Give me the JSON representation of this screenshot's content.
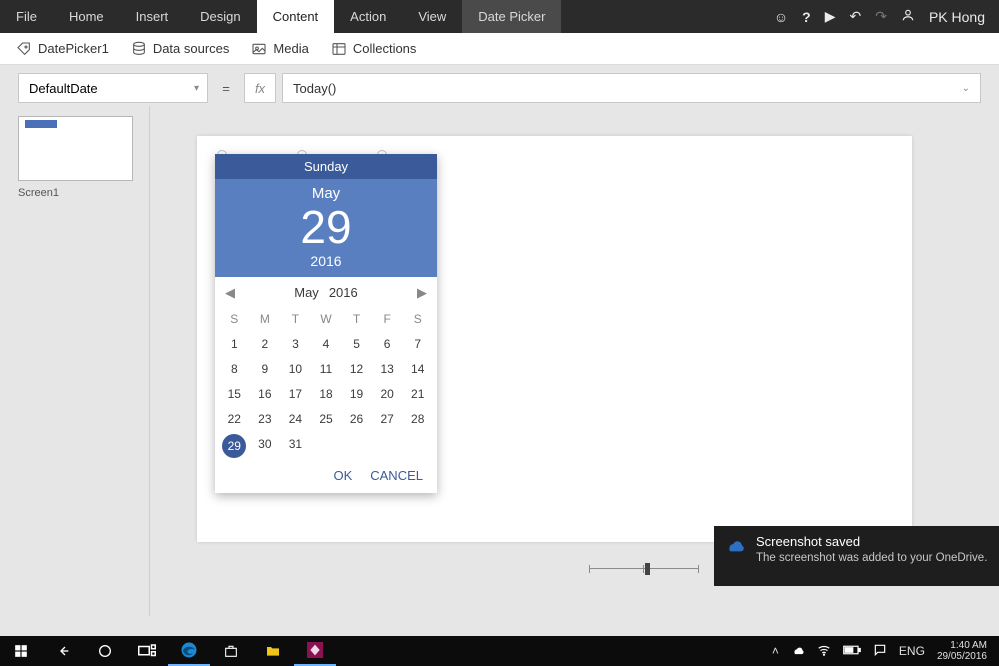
{
  "tabs": {
    "file": "File",
    "home": "Home",
    "insert": "Insert",
    "design": "Design",
    "content": "Content",
    "action": "Action",
    "view": "View",
    "datepicker": "Date Picker"
  },
  "user": {
    "name": "PK Hong"
  },
  "ribbon": {
    "control_name": "DatePicker1",
    "data_sources": "Data sources",
    "media": "Media",
    "collections": "Collections"
  },
  "formula": {
    "property": "DefaultDate",
    "fx_label": "fx",
    "expression": "Today()"
  },
  "thumbs": {
    "screen1": "Screen1"
  },
  "datepicker": {
    "dow_long": "Sunday",
    "month_long": "May",
    "day_num": "29",
    "year": "2016",
    "nav_month": "May",
    "nav_year": "2016",
    "dows": [
      "S",
      "M",
      "T",
      "W",
      "T",
      "F",
      "S"
    ],
    "weeks": [
      [
        "1",
        "2",
        "3",
        "4",
        "5",
        "6",
        "7"
      ],
      [
        "8",
        "9",
        "10",
        "11",
        "12",
        "13",
        "14"
      ],
      [
        "15",
        "16",
        "17",
        "18",
        "19",
        "20",
        "21"
      ],
      [
        "22",
        "23",
        "24",
        "25",
        "26",
        "27",
        "28"
      ],
      [
        "29",
        "30",
        "31",
        "",
        "",
        "",
        ""
      ]
    ],
    "selected_day": "29",
    "ok": "OK",
    "cancel": "CANCEL"
  },
  "toast": {
    "title": "Screenshot saved",
    "body": "The screenshot was added to your OneDrive."
  },
  "taskbar": {
    "lang": "ENG",
    "time": "1:40 AM",
    "date": "29/05/2016"
  }
}
